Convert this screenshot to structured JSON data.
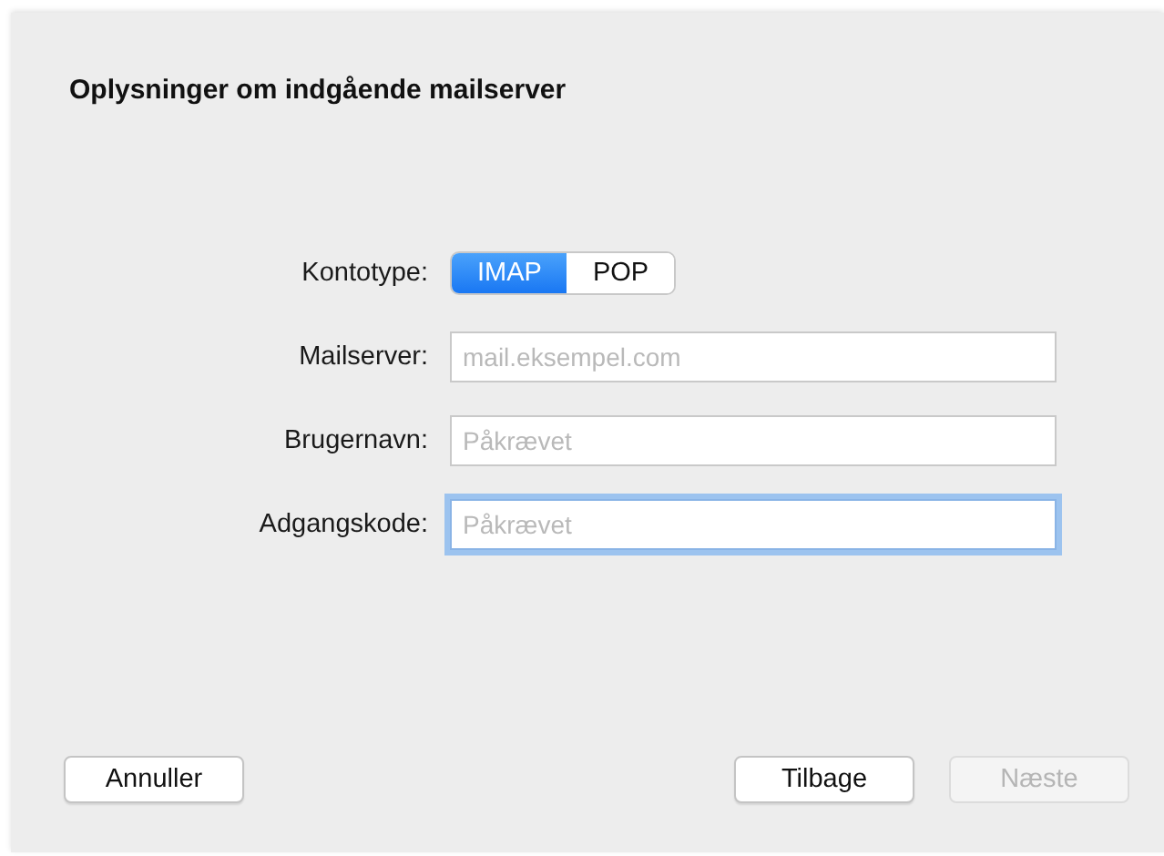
{
  "title": "Oplysninger om indgående mailserver",
  "account_type": {
    "label": "Kontotype:",
    "options": [
      {
        "label": "IMAP",
        "selected": true
      },
      {
        "label": "POP",
        "selected": false
      }
    ]
  },
  "fields": [
    {
      "label": "Mailserver:",
      "placeholder": "mail.eksempel.com",
      "focused": false
    },
    {
      "label": "Brugernavn:",
      "placeholder": "Påkrævet",
      "focused": false
    },
    {
      "label": "Adgangskode:",
      "placeholder": "Påkrævet",
      "focused": true
    }
  ],
  "left_buttons": [
    {
      "label": "Annuller",
      "disabled": false
    }
  ],
  "right_buttons": [
    {
      "label": "Tilbage",
      "disabled": false
    },
    {
      "label": "Næste",
      "disabled": true
    }
  ]
}
